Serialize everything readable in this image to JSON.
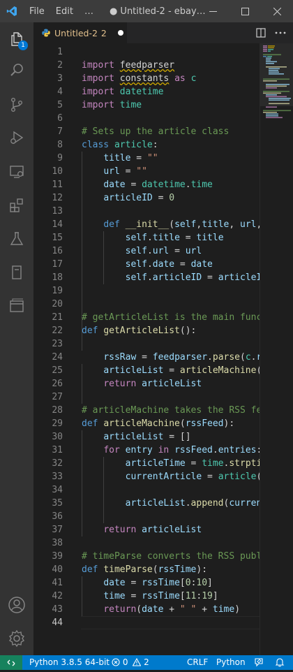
{
  "titlebar": {
    "menu_file": "File",
    "menu_edit": "Edit",
    "menu_more": "…",
    "window_title": "● Untitled-2 - ebay…",
    "minimize": "—",
    "maximize": "☐",
    "close": "✕"
  },
  "activity": {
    "explorer_badge": "1",
    "icons": [
      "explorer-icon",
      "search-icon",
      "source-control-icon",
      "run-debug-icon",
      "remote-explorer-icon",
      "extensions-icon",
      "testing-icon",
      "notebook-icon",
      "window-icon",
      "account-icon",
      "settings-gear-icon"
    ]
  },
  "tab": {
    "name": "Untitled-2",
    "problems": "2"
  },
  "editor": {
    "lines": [
      "1",
      "2",
      "3",
      "4",
      "5",
      "6",
      "7",
      "8",
      "9",
      "10",
      "11",
      "12",
      "13",
      "14",
      "15",
      "16",
      "17",
      "18",
      "19",
      "20",
      "21",
      "22",
      "23",
      "24",
      "25",
      "26",
      "27",
      "28",
      "29",
      "30",
      "31",
      "32",
      "33",
      "34",
      "35",
      "36",
      "37",
      "38",
      "39",
      "40",
      "41",
      "42",
      "43",
      "44"
    ],
    "current_line": "44"
  },
  "statusbar": {
    "interpreter": "Python 3.8.5 64-bit",
    "errors": "0",
    "warnings": "2",
    "line_ending": "CRLF",
    "language": "Python"
  },
  "colors": {
    "statusbar": "#007acc",
    "remote": "#16825d",
    "activitybar": "#333333",
    "editor": "#1e1e1e"
  }
}
